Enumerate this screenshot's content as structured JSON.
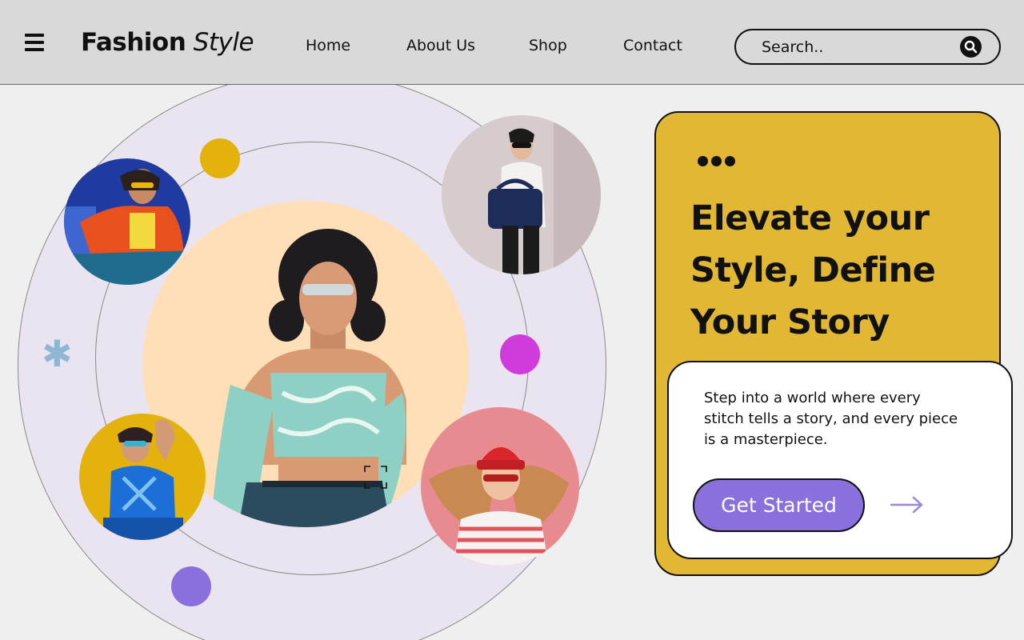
{
  "header": {
    "menu_icon": "hamburger-menu-icon",
    "brand_bold": "Fashion",
    "brand_italic": "Style",
    "nav": [
      {
        "label": "Home"
      },
      {
        "label": "About Us"
      },
      {
        "label": "Shop"
      },
      {
        "label": "Contact"
      }
    ],
    "search": {
      "placeholder": "Search..",
      "icon": "search-icon"
    }
  },
  "hero_art": {
    "photos": [
      {
        "name": "model-orange-jacket-photo"
      },
      {
        "name": "model-handbag-photo"
      },
      {
        "name": "model-teal-top-photo"
      },
      {
        "name": "model-blue-outfit-photo"
      },
      {
        "name": "model-red-beanie-photo"
      }
    ],
    "colors": {
      "ring": "#e9e4ef",
      "peach": "#ffdfb8",
      "dot_yellow": "#e3b20c",
      "dot_magenta": "#cf3cdb",
      "dot_violet": "#8a70dc",
      "asterisk": "#8fb7d4"
    }
  },
  "hero": {
    "headline_line1": "Elevate your",
    "headline_line2": "Style, Define",
    "headline_line3": "Your Story",
    "description": "Step into a world where every stitch tells a story, and every piece is a masterpiece.",
    "cta_label": "Get Started",
    "arrow_icon": "arrow-right-icon",
    "colors": {
      "card": "#e1b733",
      "button": "#8a70dc",
      "arrow": "#9b86e0"
    }
  }
}
